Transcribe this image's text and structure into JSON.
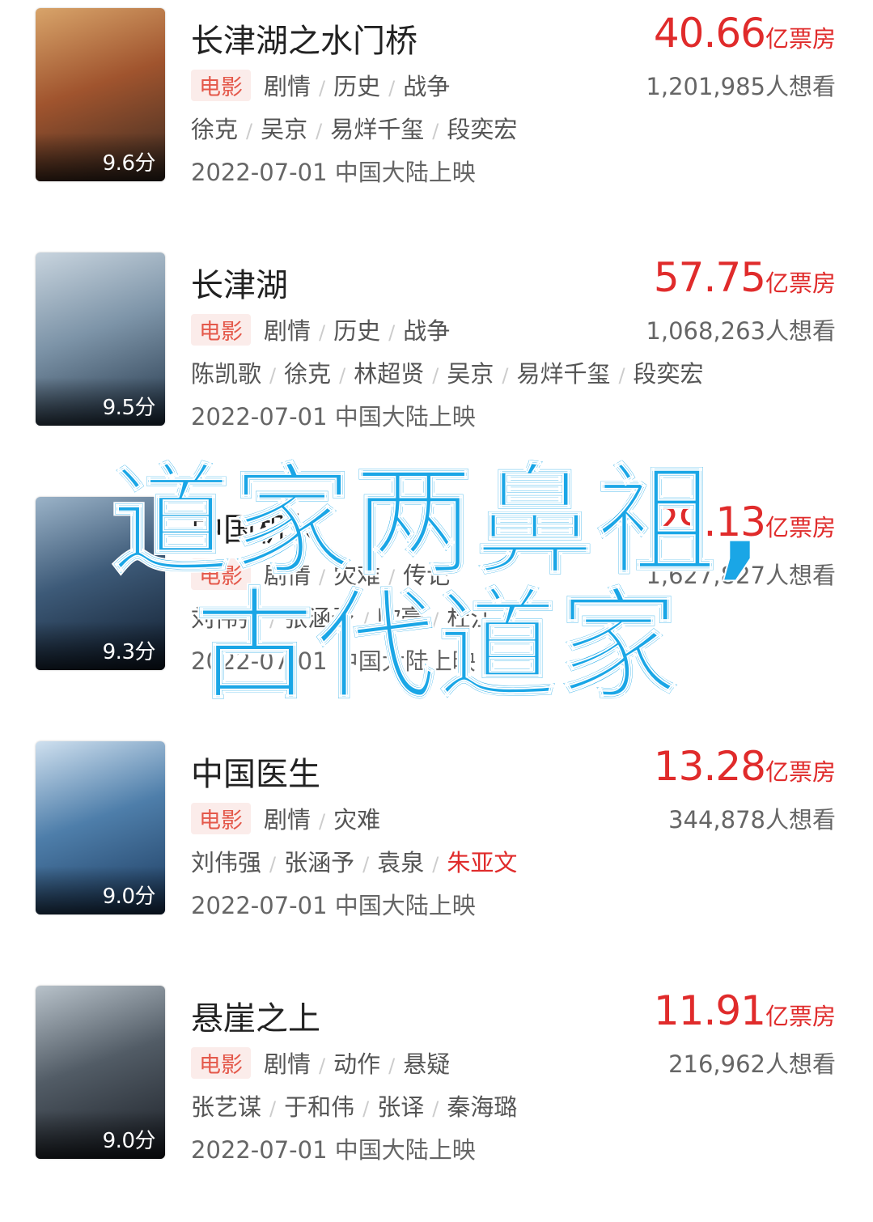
{
  "movies": [
    {
      "title": "长津湖之水门桥",
      "score": "9.6分",
      "tag": "电影",
      "genres": [
        "剧情",
        "历史",
        "战争"
      ],
      "cast": [
        "徐克",
        "吴京",
        "易烊千玺",
        "段奕宏"
      ],
      "release": "2022-07-01 中国大陆上映",
      "box_office": "40.66",
      "box_unit": "亿票房",
      "wish": "1,201,985人想看",
      "poster_colors": [
        "#3a2b22",
        "#a0542e",
        "#d8a46a"
      ]
    },
    {
      "title": "长津湖",
      "score": "9.5分",
      "tag": "电影",
      "genres": [
        "剧情",
        "历史",
        "战争"
      ],
      "cast": [
        "陈凯歌",
        "徐克",
        "林超贤",
        "吴京",
        "易烊千玺",
        "段奕宏"
      ],
      "release": "2022-07-01 中国大陆上映",
      "box_office": "57.75",
      "box_unit": "亿票房",
      "wish": "1,068,263人想看",
      "poster_colors": [
        "#23364a",
        "#7d94a8",
        "#c8d4de"
      ]
    },
    {
      "title": "中国机长",
      "score": "9.3分",
      "tag": "电影",
      "genres": [
        "剧情",
        "灾难",
        "传记"
      ],
      "cast": [
        "刘伟强",
        "张涵予",
        "欧豪",
        "杜江"
      ],
      "release": "2022-07-01 中国大陆上映",
      "box_office": "29.13",
      "box_unit": "亿票房",
      "wish": "1,627,827人想看",
      "poster_colors": [
        "#101c2c",
        "#3d5a78",
        "#9bb3c8"
      ]
    },
    {
      "title": "中国医生",
      "score": "9.0分",
      "tag": "电影",
      "genres": [
        "剧情",
        "灾难"
      ],
      "cast": [
        "刘伟强",
        "张涵予",
        "袁泉",
        "朱亚文"
      ],
      "release": "2022-07-01 中国大陆上映",
      "box_office": "13.28",
      "box_unit": "亿票房",
      "wish": "344,878人想看",
      "poster_colors": [
        "#1c3a5e",
        "#4e7eaa",
        "#cfe0ef"
      ]
    },
    {
      "title": "悬崖之上",
      "score": "9.0分",
      "tag": "电影",
      "genres": [
        "剧情",
        "动作",
        "悬疑"
      ],
      "cast": [
        "张艺谋",
        "于和伟",
        "张译",
        "秦海璐"
      ],
      "release": "2022-07-01 中国大陆上映",
      "box_office": "11.91",
      "box_unit": "亿票房",
      "wish": "216,962人想看",
      "poster_colors": [
        "#1b1f26",
        "#525c66",
        "#b8c2ca"
      ]
    }
  ],
  "overlay": {
    "line1": "道家两鼻祖,",
    "line2": "古代道家",
    "color": "#1aa6e6"
  },
  "colors": {
    "price": "#e02b2b",
    "tag_bg": "#fbecea",
    "tag_text": "#e4584a",
    "highlight_cast": "#e02b2b"
  },
  "highlighted_cast": {
    "movie_index": 3,
    "cast_index": 3
  }
}
